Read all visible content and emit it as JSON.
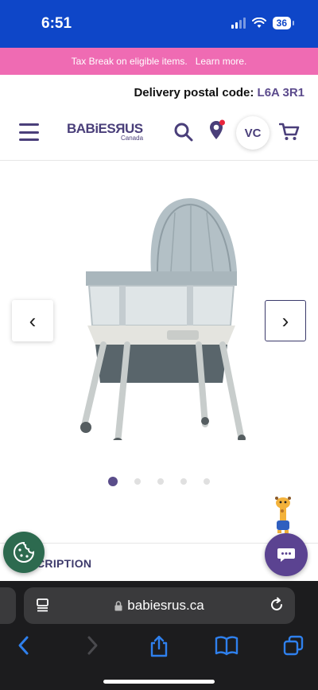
{
  "status_bar": {
    "time": "6:51",
    "battery": "36"
  },
  "promo": {
    "text": "Tax Break on eligible items.",
    "link": "Learn more."
  },
  "delivery": {
    "label": "Delivery postal code:",
    "code": "L6A 3R1"
  },
  "header": {
    "logo_main": "BABiESЯUS",
    "logo_sub": "Canada",
    "avatar_initials": "VC"
  },
  "gallery": {
    "prev_label": "‹",
    "next_label": "›",
    "dot_count": 5,
    "active_dot": 1
  },
  "description": {
    "label": "CRIPTION"
  },
  "browser": {
    "url": "babiesrus.ca"
  },
  "colors": {
    "status_bar": "#0e46c8",
    "promo": "#ef6bb3",
    "brand_purple": "#4a3f7a",
    "chat": "#5b4391",
    "cookie": "#2d6a4f",
    "safari_blue": "#2f80ed"
  }
}
